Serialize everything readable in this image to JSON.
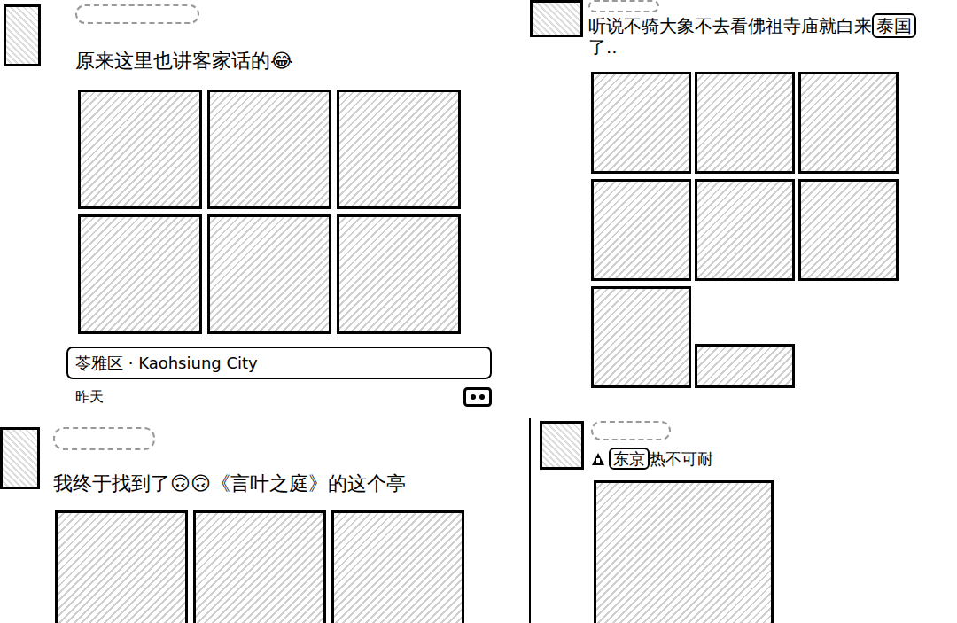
{
  "posts": [
    {
      "name_hidden": true,
      "lead_icon": false,
      "text_parts": [
        {
          "text": "原来这里也讲客家话的😂",
          "boxed": false
        }
      ],
      "photos": [
        {
          "kind": "full"
        },
        {
          "kind": "full"
        },
        {
          "kind": "full"
        },
        {
          "kind": "full"
        },
        {
          "kind": "full"
        },
        {
          "kind": "full"
        }
      ],
      "location": {
        "text": "苓雅区 · Kaohsiung City",
        "boxed": true
      },
      "time": "昨天",
      "comment_button": true
    },
    {
      "name_hidden": true,
      "lead_icon": false,
      "text_parts": [
        {
          "text": "听说不骑大象不去看佛祖寺庙就白来",
          "boxed": false
        },
        {
          "text": "泰国",
          "boxed": true
        },
        {
          "text": "了..",
          "boxed": false
        }
      ],
      "photos": [
        {
          "kind": "full"
        },
        {
          "kind": "full"
        },
        {
          "kind": "full"
        },
        {
          "kind": "full"
        },
        {
          "kind": "full"
        },
        {
          "kind": "full"
        },
        {
          "kind": "full"
        },
        {
          "kind": "short"
        }
      ],
      "comment_button": false
    },
    {
      "name_hidden": true,
      "lead_icon": false,
      "text_parts": [
        {
          "text": "我终于找到了🙃🙃《言叶之庭》的这个亭",
          "boxed": false
        }
      ],
      "photos": [
        {
          "kind": "full"
        },
        {
          "kind": "full"
        },
        {
          "kind": "full"
        }
      ],
      "comment_button": false
    },
    {
      "name_hidden": true,
      "lead_icon": true,
      "text_parts": [
        {
          "text": "东京",
          "boxed": true
        },
        {
          "text": "热不可耐",
          "boxed": false
        }
      ],
      "photos": [
        {
          "kind": "full"
        }
      ],
      "comment_button": false
    }
  ]
}
